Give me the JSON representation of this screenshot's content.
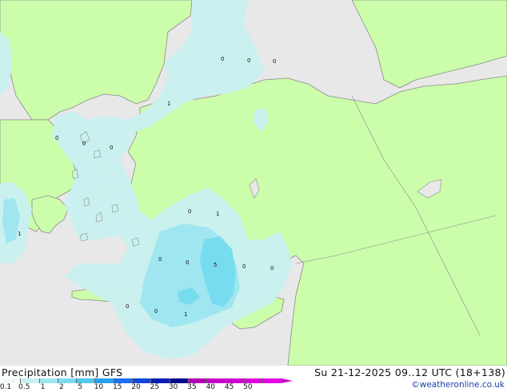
{
  "footer": {
    "title_left": "Precipitation [mm] GFS",
    "title_right": "Su 21-12-2025 09..12 UTC (18+138)",
    "credit": "©weatheronline.co.uk"
  },
  "colorbar": {
    "colors": [
      "#f0fafa",
      "#c8f0f0",
      "#a0e6f0",
      "#78dcf0",
      "#50c8f0",
      "#28a0f0",
      "#1e6ef0",
      "#1446dc",
      "#0a1eb4",
      "#0a0a8c",
      "#b400b4",
      "#c800c8",
      "#d200d2",
      "#dc00dc",
      "#e600e6"
    ],
    "ticks": [
      "0.1",
      "0.5",
      "1",
      "2",
      "5",
      "10",
      "15",
      "20",
      "25",
      "30",
      "35",
      "40",
      "45",
      "50"
    ]
  },
  "map": {
    "colors": {
      "sea": "#e8e8e8",
      "land": "#ccfdaa",
      "precip_light": "#c8f0f0",
      "precip_mid": "#a0e6f0",
      "precip_heavy": "#78dcf0",
      "coast": "#8a8a8a"
    },
    "value_labels": [
      "0",
      "0",
      "0",
      "1",
      "0",
      "0",
      "0",
      "1",
      "0",
      "1",
      "0",
      "0",
      "5",
      "0",
      "0",
      "0",
      "0",
      "1"
    ]
  }
}
